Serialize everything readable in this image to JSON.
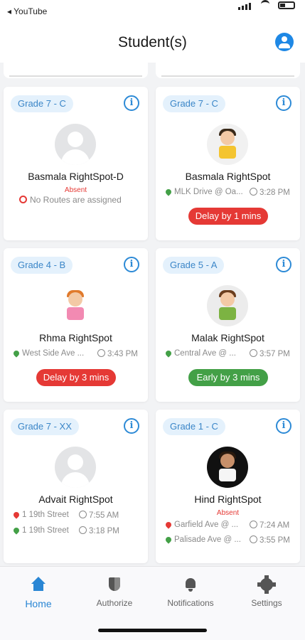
{
  "status_bar": {
    "back_label": "◂ YouTube"
  },
  "header": {
    "title": "Student(s)",
    "profile_icon": "account-circle-icon"
  },
  "colors": {
    "accent": "#2a86d4",
    "delay": "#e53935",
    "early": "#43a047",
    "grade_bg": "#e4f1fc"
  },
  "students": [
    {
      "grade": "Grade 7 - C",
      "name": "Basmala RightSpot-D",
      "absent": "Absent",
      "no_routes": "No Routes are assigned"
    },
    {
      "grade": "Grade 7 - C",
      "name": "Basmala RightSpot",
      "routes": [
        {
          "stop": "MLK Drive @ Oa...",
          "time": "3:28 PM"
        }
      ],
      "status": "Delay by 1 mins"
    },
    {
      "grade": "Grade 4 - B",
      "name": "Rhma RightSpot",
      "routes": [
        {
          "stop": "West Side Ave ...",
          "time": "3:43 PM"
        }
      ],
      "status": "Delay by 3 mins"
    },
    {
      "grade": "Grade 5 - A",
      "name": "Malak RightSpot",
      "routes": [
        {
          "stop": "Central Ave @ ...",
          "time": "3:57 PM"
        }
      ],
      "status": "Early by 3 mins"
    },
    {
      "grade": "Grade 7 - XX",
      "name": "Advait RightSpot",
      "routes": [
        {
          "stop": "1 19th Street",
          "time": "7:55 AM"
        },
        {
          "stop": "1 19th Street",
          "time": "3:18 PM"
        }
      ]
    },
    {
      "grade": "Grade 1 - C",
      "name": "Hind RightSpot",
      "absent": "Absent",
      "routes": [
        {
          "stop": "Garfield Ave @ ...",
          "time": "7:24 AM"
        },
        {
          "stop": "Palisade Ave @ ...",
          "time": "3:55 PM"
        }
      ]
    }
  ],
  "tabs": [
    {
      "label": "Home",
      "icon": "home-icon"
    },
    {
      "label": "Authorize",
      "icon": "shield-icon"
    },
    {
      "label": "Notifications",
      "icon": "bell-icon"
    },
    {
      "label": "Settings",
      "icon": "gear-icon"
    }
  ]
}
